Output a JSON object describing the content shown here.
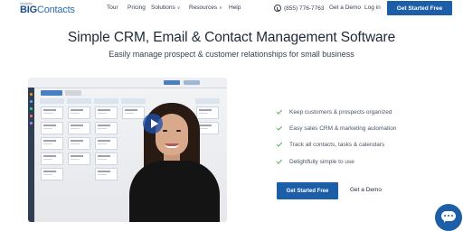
{
  "header": {
    "logo_small": "Insightly",
    "logo_brand_bold": "BIG",
    "logo_brand_light": "Contacts",
    "nav": [
      {
        "label": "Tour",
        "has_dropdown": false
      },
      {
        "label": "Pricing",
        "has_dropdown": false
      },
      {
        "label": "Solutions",
        "has_dropdown": true
      },
      {
        "label": "Resources",
        "has_dropdown": true
      },
      {
        "label": "Help",
        "has_dropdown": false
      }
    ],
    "phone": "(855) 776-7763",
    "demo_label": "Get a Demo",
    "login_label": "Log in",
    "cta_label": "Get Started Free"
  },
  "hero": {
    "headline": "Simple CRM, Email & Contact Management Software",
    "subheadline": "Easily manage prospect & customer relationships for small business"
  },
  "video": {
    "play_icon": "play-icon"
  },
  "features": [
    "Keep customers & prospects organized",
    "Easy sales CRM & marketing automation",
    "Track all contacts, tasks & calendars",
    "Delightfully simple to use"
  ],
  "actions": {
    "primary_label": "Get Started Free",
    "secondary_label": "Get a Demo"
  },
  "chat_icon": "chat-bubble-icon",
  "colors": {
    "brand_blue": "#1c5fa8",
    "check_green": "#4caf50",
    "text_dark": "#1f2937"
  }
}
